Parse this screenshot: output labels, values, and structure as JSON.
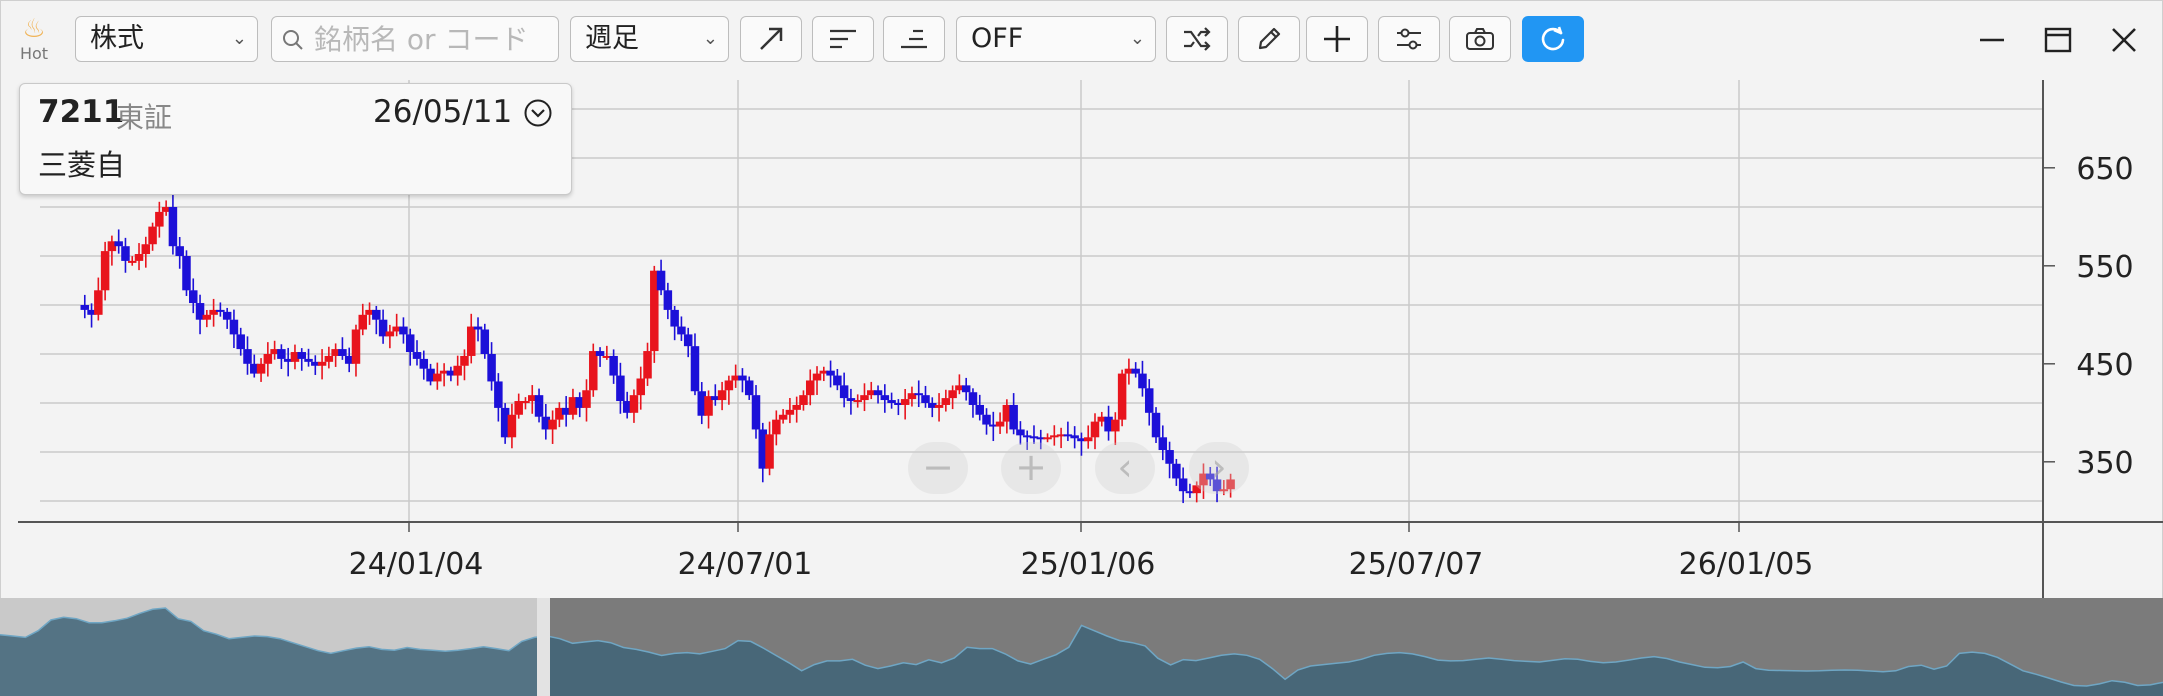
{
  "toolbar": {
    "hot_label": "Hot",
    "market_select": "株式",
    "search_placeholder": "銘柄名 or コード",
    "period_select": "週足",
    "indicator_select": "OFF",
    "icons": [
      "trend-line-icon",
      "align-left-icon",
      "align-right-icon",
      "shuffle-icon",
      "pencil-icon",
      "crosshair-plus-icon",
      "sliders-icon",
      "camera-icon",
      "refresh-icon"
    ],
    "accent_color": "#2196f3"
  },
  "window": {
    "icons": [
      "minimize-icon",
      "maximize-icon",
      "close-icon"
    ]
  },
  "info": {
    "code": "7211",
    "exchange": "東証",
    "date": "26/05/11",
    "name": "三菱自"
  },
  "chart_data": {
    "type": "candlestick",
    "y_ticks": [
      650,
      550,
      450,
      350
    ],
    "x_ticks": [
      "24/01/04",
      "24/07/01",
      "25/01/06",
      "25/07/07",
      "26/01/05"
    ],
    "ylim": [
      300,
      710
    ],
    "up_color": "#e8141d",
    "down_color": "#1c10d8",
    "grid": true,
    "weekly_closes": [
      510,
      505,
      500,
      525,
      565,
      575,
      570,
      555,
      555,
      562,
      572,
      590,
      605,
      610,
      570,
      560,
      525,
      512,
      495,
      500,
      505,
      503,
      495,
      480,
      465,
      450,
      440,
      450,
      460,
      465,
      455,
      452,
      462,
      455,
      452,
      448,
      452,
      458,
      465,
      458,
      450,
      485,
      500,
      505,
      495,
      478,
      483,
      488,
      480,
      462,
      455,
      445,
      432,
      440,
      443,
      438,
      448,
      458,
      488,
      485,
      460,
      432,
      405,
      375,
      398,
      412,
      412,
      418,
      396,
      383,
      393,
      405,
      398,
      416,
      405,
      423,
      463,
      458,
      458,
      438,
      412,
      400,
      418,
      435,
      463,
      545,
      525,
      505,
      488,
      480,
      468,
      422,
      397,
      417,
      413,
      423,
      433,
      438,
      433,
      418,
      383,
      343,
      378,
      393,
      398,
      403,
      408,
      418,
      433,
      440,
      443,
      438,
      428,
      415,
      412,
      413,
      418,
      423,
      418,
      413,
      410,
      408,
      414,
      420,
      418,
      410,
      405,
      408,
      415,
      423,
      428,
      421,
      408,
      398,
      388,
      386,
      391,
      408,
      383,
      377,
      376,
      375,
      374,
      375,
      377,
      378,
      377,
      374,
      371,
      375,
      391,
      396,
      381,
      393,
      440,
      445,
      440,
      425,
      400,
      375,
      362,
      348,
      333,
      320,
      318,
      326,
      338,
      332,
      320,
      322,
      332
    ]
  }
}
